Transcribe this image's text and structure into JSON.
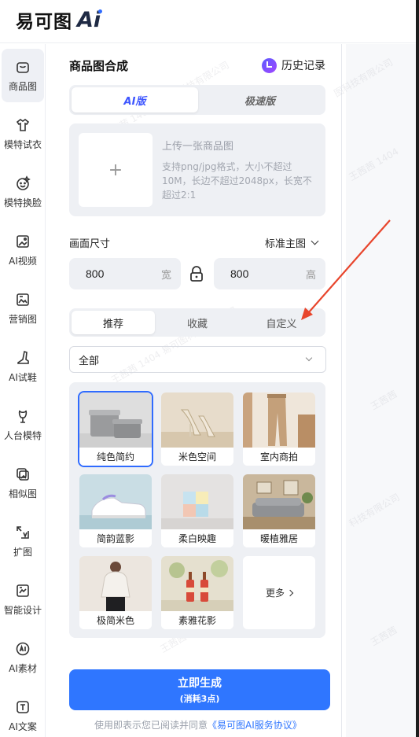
{
  "brand": {
    "logo_text": "易可图",
    "logo_ai": "Ai"
  },
  "sidebar": {
    "items": [
      {
        "label": "商品图",
        "icon": "bag-icon",
        "active": true
      },
      {
        "label": "模特试衣",
        "icon": "shirt-icon"
      },
      {
        "label": "模特换脸",
        "icon": "face-icon"
      },
      {
        "label": "AI视频",
        "icon": "video-icon"
      },
      {
        "label": "营销图",
        "icon": "poster-icon"
      },
      {
        "label": "AI试鞋",
        "icon": "shoe-icon"
      },
      {
        "label": "人台模特",
        "icon": "mannequin-icon"
      },
      {
        "label": "相似图",
        "icon": "similar-image-icon"
      },
      {
        "label": "扩图",
        "icon": "expand-icon"
      },
      {
        "label": "智能设计",
        "icon": "design-icon"
      },
      {
        "label": "AI素材",
        "icon": "ai-material-icon"
      },
      {
        "label": "AI文案",
        "icon": "text-icon"
      }
    ]
  },
  "panel": {
    "title": "商品图合成",
    "history_label": "历史记录",
    "modes": [
      "AI版",
      "极速版"
    ],
    "active_mode": "AI版",
    "upload": {
      "title": "上传一张商品图",
      "desc": "支持png/jpg格式，大小不超过10M，长边不超过2048px，长宽不超过2:1"
    },
    "size": {
      "label": "画面尺寸",
      "preset": "标准主图",
      "width": "800",
      "width_unit": "宽",
      "height": "800",
      "height_unit": "高"
    },
    "tabs": [
      "推荐",
      "收藏",
      "自定义"
    ],
    "active_tab": "推荐",
    "filter": {
      "value": "全部"
    },
    "scenes": [
      {
        "label": "纯色简约",
        "selected": true
      },
      {
        "label": "米色空间"
      },
      {
        "label": "室内商拍"
      },
      {
        "label": "简韵蓝影"
      },
      {
        "label": "柔白映趣"
      },
      {
        "label": "暖植雅居"
      },
      {
        "label": "极简米色"
      },
      {
        "label": "素雅花影"
      }
    ],
    "more_label": "更多",
    "generate": {
      "label": "立即生成",
      "cost": "(消耗3点)"
    },
    "agreement": {
      "prefix": "使用即表示您已阅读并同意",
      "link": "《易可图AI服务协议》"
    }
  },
  "colors": {
    "accent": "#2f76ff",
    "mode_active": "#3d55ff",
    "annotation_arrow": "#e8452c"
  }
}
